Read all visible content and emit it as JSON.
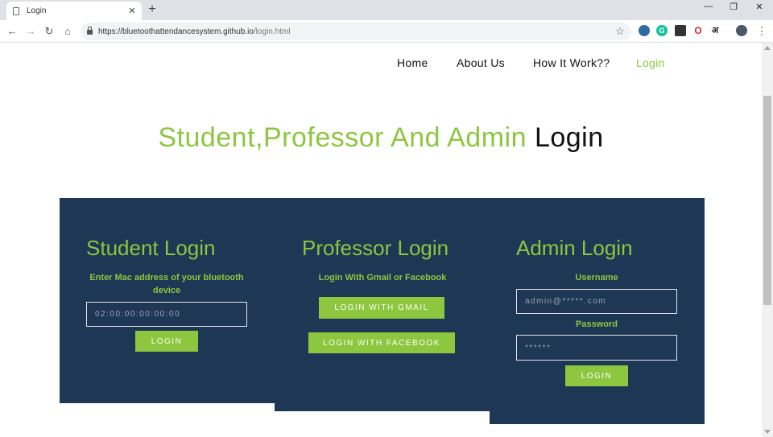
{
  "browser": {
    "tab_title": "Login",
    "url_host": "https://bluetoothattendancesystem.github.io",
    "url_path": "/login.html",
    "extension_opera_label": "O",
    "extension_hindi_label": "अ"
  },
  "nav": {
    "home": "Home",
    "about": "About Us",
    "how": "How It Work??",
    "login": "Login"
  },
  "heading": {
    "green": "Student,Professor And Admin",
    "dark": "Login"
  },
  "student": {
    "title": "Student Login",
    "hint": "Enter Mac address of your bluetooth device",
    "mac_placeholder": "02:00:00:00:00:00",
    "login_label": "LOGIN"
  },
  "professor": {
    "title": "Professor Login",
    "hint": "Login With Gmail or Facebook",
    "gmail_label": "LOGIN WITH GMAIL",
    "facebook_label": "LOGIN WITH FACEBOOK"
  },
  "admin": {
    "title": "Admin Login",
    "username_label": "Username",
    "username_placeholder": "admin@*****.com",
    "password_label": "Password",
    "password_placeholder": "******",
    "login_label": "LOGIN"
  },
  "colors": {
    "accent": "#8dc63f",
    "panel": "#1e3754"
  }
}
